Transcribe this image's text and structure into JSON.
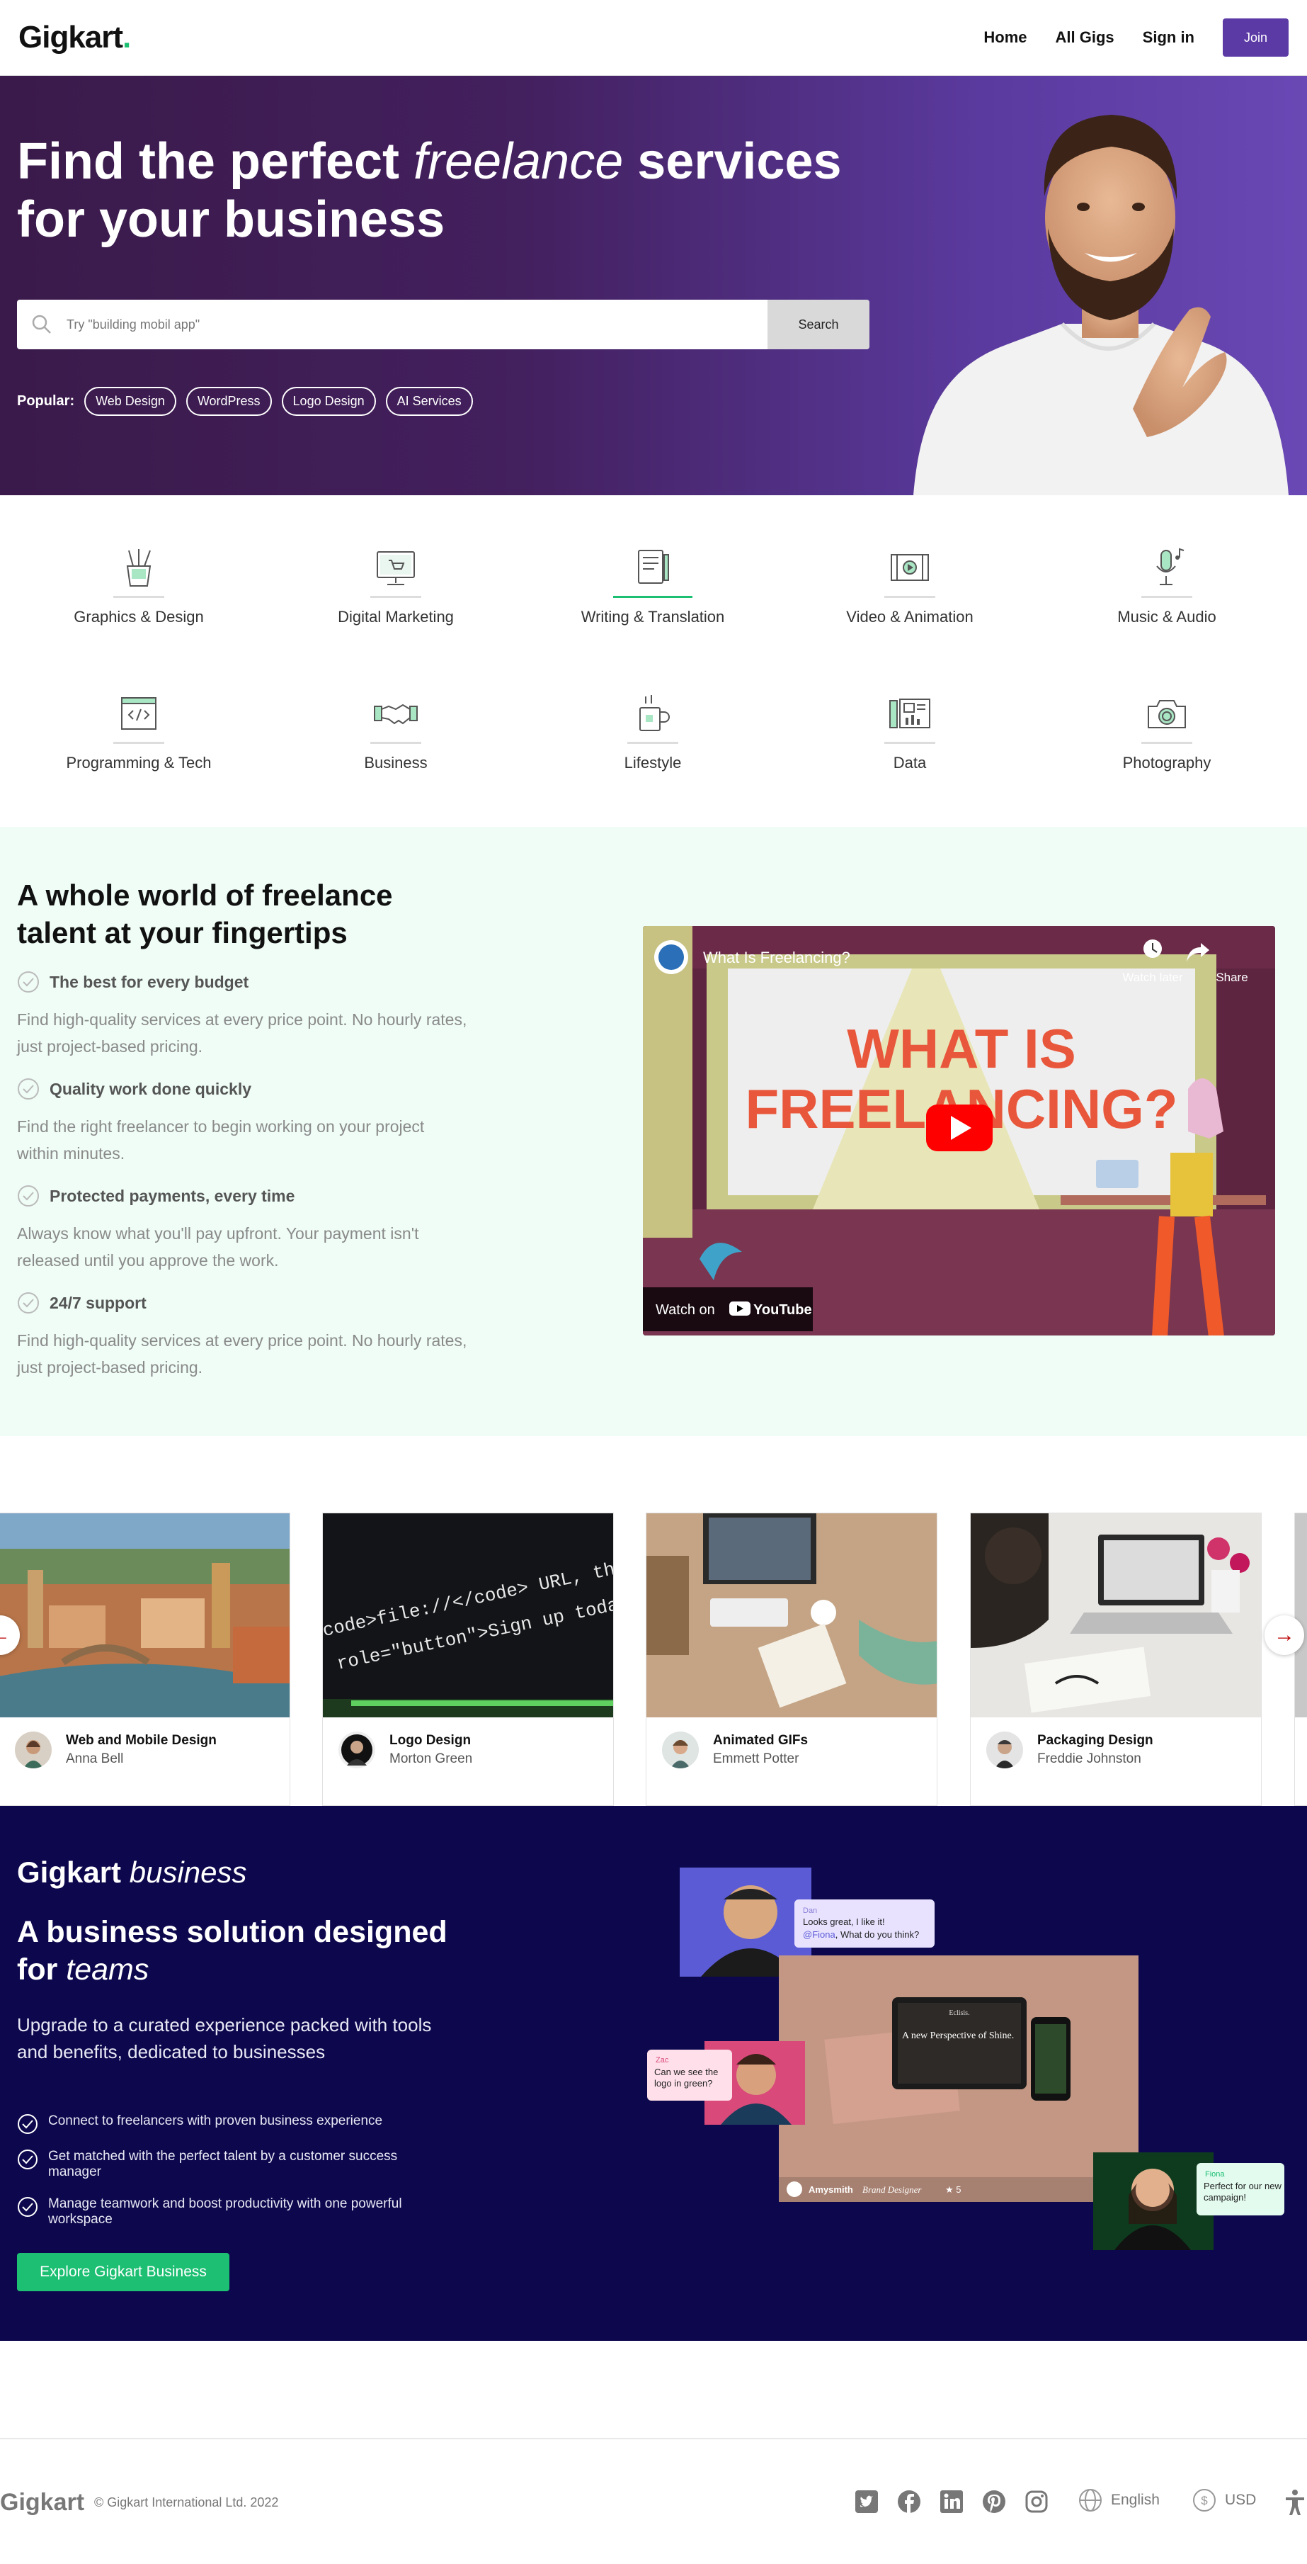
{
  "header": {
    "logo": "Gigkart",
    "logo_dot": ".",
    "nav": [
      "Home",
      "All Gigs",
      "Sign in"
    ],
    "join_label": "Join"
  },
  "hero": {
    "title_part1": "Find the perfect ",
    "title_em": "freelance",
    "title_part2": " services for your business",
    "search_placeholder": "Try \"building mobil app\"",
    "search_button": "Search",
    "popular_label": "Popular:",
    "popular_tags": [
      "Web Design",
      "WordPress",
      "Logo Design",
      "AI Services"
    ]
  },
  "categories": [
    {
      "label": "Graphics & Design",
      "icon": "pencil-cup-icon"
    },
    {
      "label": "Digital Marketing",
      "icon": "monitor-cart-icon"
    },
    {
      "label": "Writing & Translation",
      "icon": "document-pen-icon"
    },
    {
      "label": "Video & Animation",
      "icon": "film-icon"
    },
    {
      "label": "Music & Audio",
      "icon": "microphone-icon"
    },
    {
      "label": "Programming & Tech",
      "icon": "code-window-icon"
    },
    {
      "label": "Business",
      "icon": "handshake-icon"
    },
    {
      "label": "Lifestyle",
      "icon": "mug-icon"
    },
    {
      "label": "Data",
      "icon": "chart-dashboard-icon"
    },
    {
      "label": "Photography",
      "icon": "camera-icon"
    }
  ],
  "features": {
    "title": "A whole world of freelance talent at your fingertips",
    "items": [
      {
        "title": "The best for every budget",
        "desc": "Find high-quality services at every price point. No hourly rates, just project-based pricing."
      },
      {
        "title": "Quality work done quickly",
        "desc": "Find the right freelancer to begin working on your project within minutes."
      },
      {
        "title": "Protected payments, every time",
        "desc": "Always know what you'll pay upfront. Your payment isn't released until you approve the work."
      },
      {
        "title": "24/7 support",
        "desc": "Find high-quality services at every price point. No hourly rates, just project-based pricing."
      }
    ],
    "video": {
      "title": "What Is Freelancing?",
      "watch_later": "Watch later",
      "share": "Share",
      "headline_line1": "WHAT IS",
      "headline_line2": "FREELANCING?",
      "watch_on": "Watch on",
      "youtube": "YouTube"
    }
  },
  "gigs": [
    {
      "title": "Web and Mobile Design",
      "author": "Anna Bell"
    },
    {
      "title": "Logo Design",
      "author": "Morton Green"
    },
    {
      "title": "Animated GIFs",
      "author": "Emmett Potter"
    },
    {
      "title": "Packaging Design",
      "author": "Freddie Johnston"
    }
  ],
  "code_snippet": {
    "line1": "code>file://</code> URL, the \"next\"",
    "line2": "role=\"button\">Sign up today</a></"
  },
  "business": {
    "brand": "Gigkart",
    "brand_em": "business",
    "headline_part1": "A business solution designed for ",
    "headline_em": "teams",
    "desc": "Upgrade to a curated experience packed with tools and benefits, dedicated to businesses",
    "bullets": [
      "Connect to freelancers with proven business experience",
      "Get matched with the perfect talent by a customer success manager",
      "Manage teamwork and boost productivity with one powerful workspace"
    ],
    "cta": "Explore Gigkart Business",
    "chat1_name": "Dan",
    "chat1_line1": "Looks great, I like it!",
    "chat1_mention": "@Fiona",
    "chat1_line2": ", What do you think?",
    "chat2_name": "Zac",
    "chat2_text": "Can we see the logo in green?",
    "chat3_name": "Fiona",
    "chat3_text": "Perfect for our new campaign!",
    "mock_brand": "Eclisis.",
    "mock_title": "A new Perspective of Shine.",
    "seller_name": "Amysmith",
    "seller_role": "Brand Designer",
    "seller_rating": "5"
  },
  "footer": {
    "logo": "Gigkart",
    "copyright": "© Gigkart International Ltd. 2022",
    "socials": [
      "twitter-icon",
      "facebook-icon",
      "linkedin-icon",
      "pinterest-icon",
      "instagram-icon"
    ],
    "language": "English",
    "currency": "USD"
  },
  "colors": {
    "brand_green": "#1dbf73",
    "join_purple": "#5b3aa6",
    "business_navy": "#0d084d",
    "features_bg": "#effdf6"
  }
}
